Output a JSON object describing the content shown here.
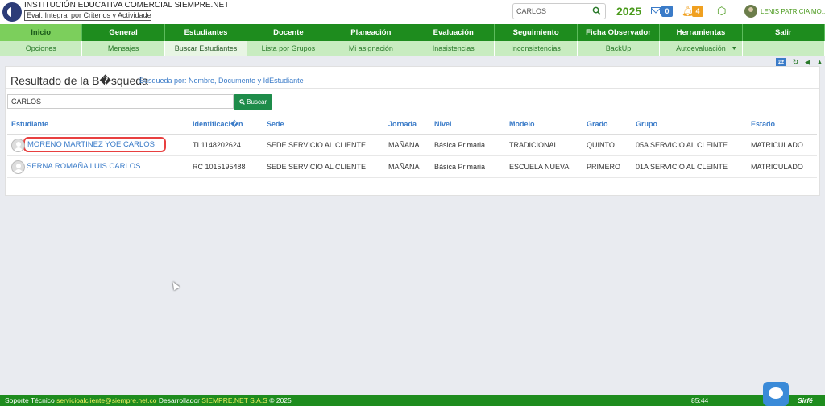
{
  "header": {
    "institution": "INSTITUCIÓN EDUCATIVA COMERCIAL SIEMPRE.NET",
    "evaluation_select": "Eval. Integral por Criterios y Actividades",
    "search_value": "CARLOS",
    "year": "2025",
    "messages_count": "0",
    "notifications_count": "4",
    "user_name": "LENIS PATRICIA MO..."
  },
  "nav": {
    "items": [
      "Inicio",
      "General",
      "Estudiantes",
      "Docente",
      "Planeación",
      "Evaluación",
      "Seguimiento",
      "Ficha Observador",
      "Herramientas",
      "Salir"
    ]
  },
  "subnav": {
    "items": [
      "Opciones",
      "Mensajes",
      "Buscar Estudiantes",
      "Lista por Grupos",
      "Mi asignación",
      "Inasistencias",
      "Inconsistencias",
      "BackUp",
      "Autoevaluación",
      ""
    ]
  },
  "results": {
    "title": "Resultado de la B�squeda",
    "subtitle": "Busqueda por: Nombre, Documento y IdEstudiante",
    "query": "CARLOS",
    "button_label": "Buscar",
    "columns": [
      "Estudiante",
      "Identificaci�n",
      "Sede",
      "Jornada",
      "Nivel",
      "Modelo",
      "Grado",
      "Grupo",
      "Estado"
    ],
    "rows": [
      {
        "name": "MORENO MARTINEZ YOE CARLOS",
        "id": "TI  1148202624",
        "sede": "SEDE SERVICIO AL CLIENTE",
        "jornada": "MAÑANA",
        "nivel": "Básica Primaria",
        "modelo": "TRADICIONAL",
        "grado": "QUINTO",
        "grupo": "05A SERVICIO AL CLEINTE",
        "estado": "MATRICULADO"
      },
      {
        "name": "SERNA ROMAÑA LUIS CARLOS",
        "id": "RC  1015195488",
        "sede": "SEDE SERVICIO AL CLIENTE",
        "jornada": "MAÑANA",
        "nivel": "Básica Primaria",
        "modelo": "ESCUELA NUEVA",
        "grado": "PRIMERO",
        "grupo": "01A SERVICIO AL CLEINTE",
        "estado": "MATRICULADO"
      }
    ]
  },
  "footer": {
    "support_label": "Soporte Técnico",
    "support_email": "servicioalcliente@siempre.net.co",
    "developer_label": "Desarrollador",
    "developer_name": "SIEMPRE.NET S.A.S",
    "copyright": "© 2025",
    "timer": "85:44",
    "brand": "Sirfé"
  },
  "colors": {
    "nav_green": "#1e8c1e",
    "active_green": "#7ccf5c",
    "link_blue": "#3a7bc8",
    "highlight_red": "#e84040"
  }
}
